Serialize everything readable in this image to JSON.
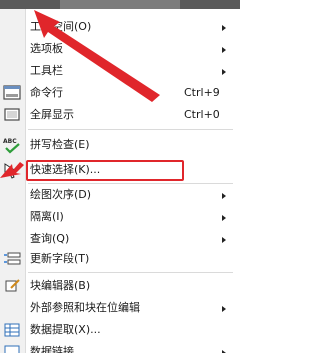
{
  "menu": {
    "items": [
      {
        "label": "工作空间(O)",
        "shortcut": "",
        "has_submenu": true
      },
      {
        "label": "选项板",
        "shortcut": "",
        "has_submenu": true
      },
      {
        "label": "工具栏",
        "shortcut": "",
        "has_submenu": true
      },
      {
        "label": "命令行",
        "shortcut": "Ctrl+9",
        "has_submenu": false
      },
      {
        "label": "全屏显示",
        "shortcut": "Ctrl+0",
        "has_submenu": false
      },
      {
        "label": "拼写检查(E)",
        "shortcut": "",
        "has_submenu": false
      },
      {
        "label": "快速选择(K)...",
        "shortcut": "",
        "has_submenu": false
      },
      {
        "label": "绘图次序(D)",
        "shortcut": "",
        "has_submenu": true
      },
      {
        "label": "隔离(I)",
        "shortcut": "",
        "has_submenu": true
      },
      {
        "label": "查询(Q)",
        "shortcut": "",
        "has_submenu": true
      },
      {
        "label": "更新字段(T)",
        "shortcut": "",
        "has_submenu": false
      },
      {
        "label": "块编辑器(B)",
        "shortcut": "",
        "has_submenu": false
      },
      {
        "label": "外部参照和块在位编辑",
        "shortcut": "",
        "has_submenu": true
      },
      {
        "label": "数据提取(X)...",
        "shortcut": "",
        "has_submenu": false
      },
      {
        "label": "数据链接",
        "shortcut": "",
        "has_submenu": true
      }
    ]
  },
  "icons": {
    "abc_text": "ABC",
    "check_color": "#2e9d3a",
    "spell_check_color": "#2e7bd6"
  },
  "annotation": {
    "color": "#e0262b",
    "highlighted_item": "快速选择(K)..."
  }
}
